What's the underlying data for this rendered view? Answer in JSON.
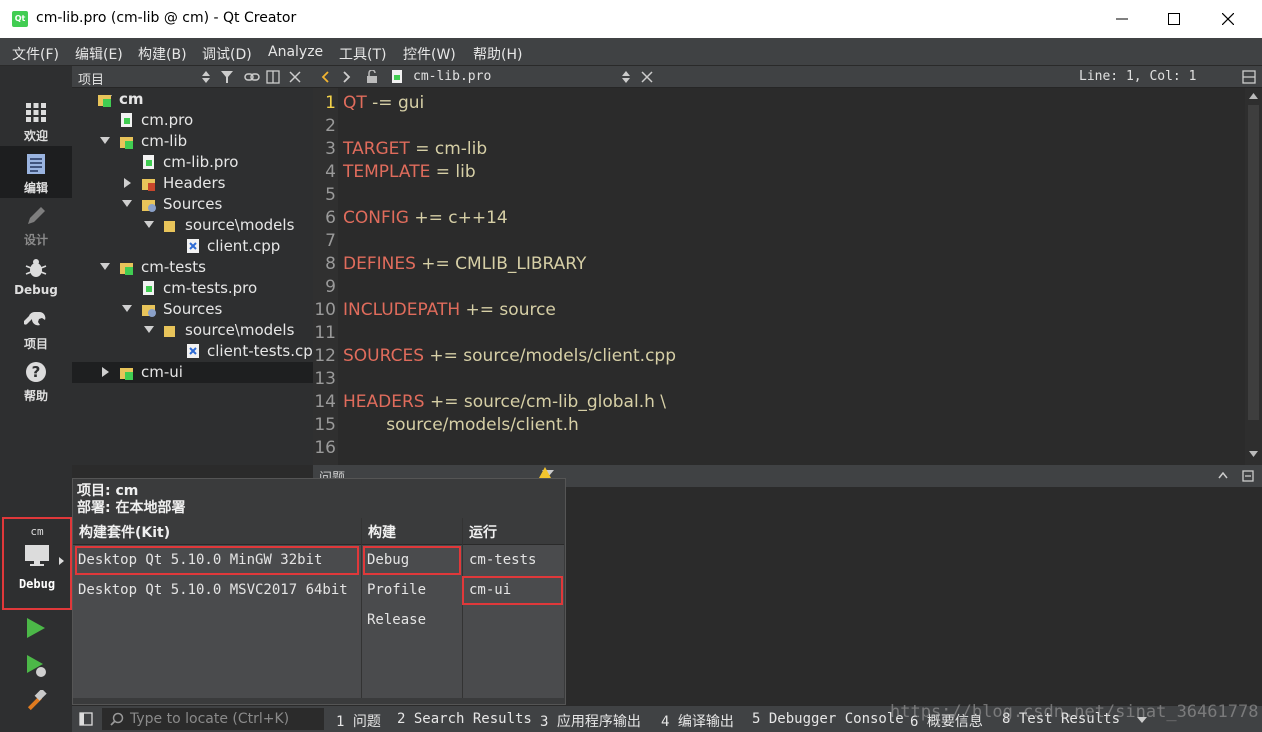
{
  "window": {
    "title": "cm-lib.pro (cm-lib @ cm) - Qt Creator",
    "logo_text": "Qt"
  },
  "menu": [
    "文件(F)",
    "编辑(E)",
    "构建(B)",
    "调试(D)",
    "Analyze",
    "工具(T)",
    "控件(W)",
    "帮助(H)"
  ],
  "modes": [
    {
      "label": "欢迎",
      "icon": "grid-icon"
    },
    {
      "label": "编辑",
      "icon": "document-icon"
    },
    {
      "label": "设计",
      "icon": "pencil-icon"
    },
    {
      "label": "Debug",
      "icon": "bug-icon"
    },
    {
      "label": "项目",
      "icon": "wrench-icon"
    },
    {
      "label": "帮助",
      "icon": "help-icon"
    }
  ],
  "kit_selector": {
    "project": "cm",
    "mode": "Debug"
  },
  "project_pane": {
    "title": "项目"
  },
  "tree": [
    {
      "label": "cm"
    },
    {
      "label": "cm.pro"
    },
    {
      "label": "cm-lib"
    },
    {
      "label": "cm-lib.pro"
    },
    {
      "label": "Headers"
    },
    {
      "label": "Sources"
    },
    {
      "label": "source\\models"
    },
    {
      "label": "client.cpp"
    },
    {
      "label": "cm-tests"
    },
    {
      "label": "cm-tests.pro"
    },
    {
      "label": "Sources"
    },
    {
      "label": "source\\models"
    },
    {
      "label": "client-tests.cpp"
    },
    {
      "label": "cm-ui"
    }
  ],
  "editor": {
    "filename": "cm-lib.pro",
    "cursor": "Line: 1, Col: 1",
    "lines": [
      {
        "n": "1",
        "kw": "QT",
        "rest": " -= gui"
      },
      {
        "n": "2",
        "kw": "",
        "rest": ""
      },
      {
        "n": "3",
        "kw": "TARGET",
        "rest": " = cm-lib"
      },
      {
        "n": "4",
        "kw": "TEMPLATE",
        "rest": " = lib"
      },
      {
        "n": "5",
        "kw": "",
        "rest": ""
      },
      {
        "n": "6",
        "kw": "CONFIG",
        "rest": " += c++14"
      },
      {
        "n": "7",
        "kw": "",
        "rest": ""
      },
      {
        "n": "8",
        "kw": "DEFINES",
        "rest": " += CMLIB_LIBRARY"
      },
      {
        "n": "9",
        "kw": "",
        "rest": ""
      },
      {
        "n": "10",
        "kw": "INCLUDEPATH",
        "rest": " += source"
      },
      {
        "n": "11",
        "kw": "",
        "rest": ""
      },
      {
        "n": "12",
        "kw": "SOURCES",
        "rest": " += source/models/client.cpp"
      },
      {
        "n": "13",
        "kw": "",
        "rest": ""
      },
      {
        "n": "14",
        "kw": "HEADERS",
        "rest": " += source/cm-lib_global.h \\"
      },
      {
        "n": "15",
        "kw": "",
        "rest": "        source/models/client.h"
      },
      {
        "n": "16",
        "kw": "",
        "rest": ""
      }
    ]
  },
  "issues_pane": {
    "title": "问题"
  },
  "kit_popup": {
    "project_line": "项目: cm",
    "deploy_line": "部署: 在本地部署",
    "kit_header": "构建套件(Kit)",
    "build_header": "构建",
    "run_header": "运行",
    "kits": [
      "Desktop Qt 5.10.0 MinGW 32bit",
      "Desktop Qt 5.10.0 MSVC2017 64bit"
    ],
    "builds": [
      "Debug",
      "Profile",
      "Release"
    ],
    "runs": [
      "cm-tests",
      "cm-ui"
    ]
  },
  "statusbar": {
    "locate_placeholder": "Type to locate (Ctrl+K)",
    "tabs": [
      "1 问题",
      "2 Search Results",
      "3 应用程序输出",
      "4 编译输出",
      "5 Debugger Console",
      "6 概要信息",
      "8 Test Results"
    ]
  },
  "watermark": "https://blog.csdn.net/sinat_36461778",
  "colors": {
    "accent_red": "#e0383a",
    "keyword": "#e06c5c",
    "code_text": "#d6cfa6",
    "current_line_number": "#f3d24a"
  }
}
